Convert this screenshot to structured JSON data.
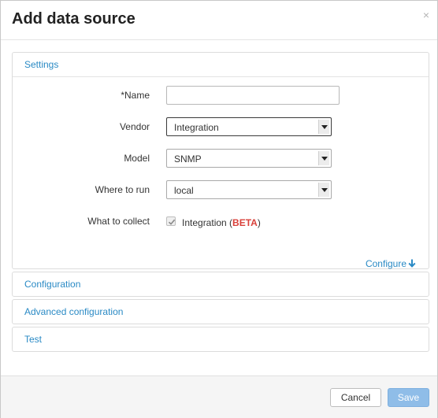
{
  "dialog": {
    "title": "Add data source",
    "close_glyph": "×"
  },
  "settings": {
    "header": "Settings",
    "name_label": "*Name",
    "name_value": "",
    "vendor_label": "Vendor",
    "vendor_value": "Integration",
    "model_label": "Model",
    "model_value": "SNMP",
    "where_label": "Where to run",
    "where_value": "local",
    "collect_label": "What to collect",
    "collect_item": "Integration (",
    "collect_badge": "BETA",
    "collect_close": ")",
    "collect_checked": true,
    "configure_link": "Configure"
  },
  "sections": {
    "configuration": "Configuration",
    "advanced": "Advanced configuration",
    "test": "Test"
  },
  "footer": {
    "cancel": "Cancel",
    "save": "Save"
  },
  "colors": {
    "link": "#2a8ac5",
    "beta": "#d9403a",
    "save_button": "#8fbde8"
  }
}
